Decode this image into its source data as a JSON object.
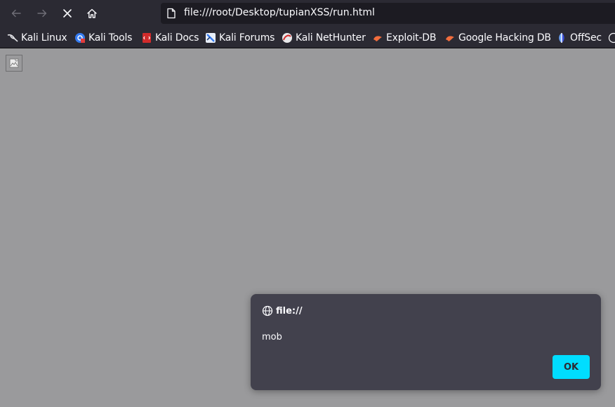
{
  "toolbar": {
    "back_icon": "arrow-left-icon",
    "forward_icon": "arrow-right-icon",
    "stop_icon": "close-icon",
    "home_icon": "home-icon",
    "url": "file:///root/Desktop/tupianXSS/run.html"
  },
  "bookmarks": [
    {
      "label": "Kali Linux",
      "icon": "kali-dragon-icon"
    },
    {
      "label": "Kali Tools",
      "icon": "kali-tools-icon"
    },
    {
      "label": "Kali Docs",
      "icon": "kali-docs-icon"
    },
    {
      "label": "Kali Forums",
      "icon": "kali-forums-icon"
    },
    {
      "label": "Kali NetHunter",
      "icon": "kali-nethunter-icon"
    },
    {
      "label": "Exploit-DB",
      "icon": "exploit-db-icon"
    },
    {
      "label": "Google Hacking DB",
      "icon": "ghdb-icon"
    },
    {
      "label": "OffSec",
      "icon": "offsec-icon"
    }
  ],
  "content": {
    "broken_image_icon": "broken-image-icon"
  },
  "dialog": {
    "origin": "file://",
    "message": "mob",
    "ok_label": "OK"
  },
  "colors": {
    "toolbar_bg": "#2b2a33",
    "url_bg": "#1c1b22",
    "page_bg": "#9a9a9c",
    "dialog_bg": "#42414d",
    "accent": "#00ddff"
  }
}
